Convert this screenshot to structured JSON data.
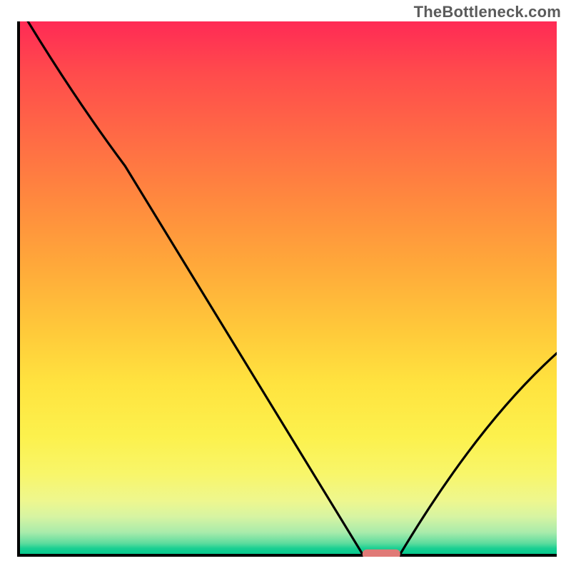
{
  "watermark": "TheBottleneck.com",
  "chart_data": {
    "type": "line",
    "title": "",
    "xlabel": "",
    "ylabel": "",
    "xlim": [
      0,
      100
    ],
    "ylim": [
      0,
      100
    ],
    "grid": false,
    "background_gradient": [
      "#ff2a55",
      "#ff6b45",
      "#ffc93a",
      "#fcf14d",
      "#d7f4a2",
      "#07c98e"
    ],
    "x": [
      2,
      20,
      64,
      71,
      100
    ],
    "y": [
      100,
      73,
      0.5,
      0.5,
      38
    ],
    "marker": {
      "type": "pill",
      "color": "#e07a77",
      "x_range": [
        64,
        71
      ],
      "y": 0.5
    },
    "curve_note": "V-shaped curve with knee near x≈20 and flat minimum at x≈64–71; interpolated points are estimates."
  },
  "colors": {
    "axis": "#000000",
    "curve": "#000000",
    "marker": "#e07a77",
    "watermark_text": "#5b5b5b"
  }
}
